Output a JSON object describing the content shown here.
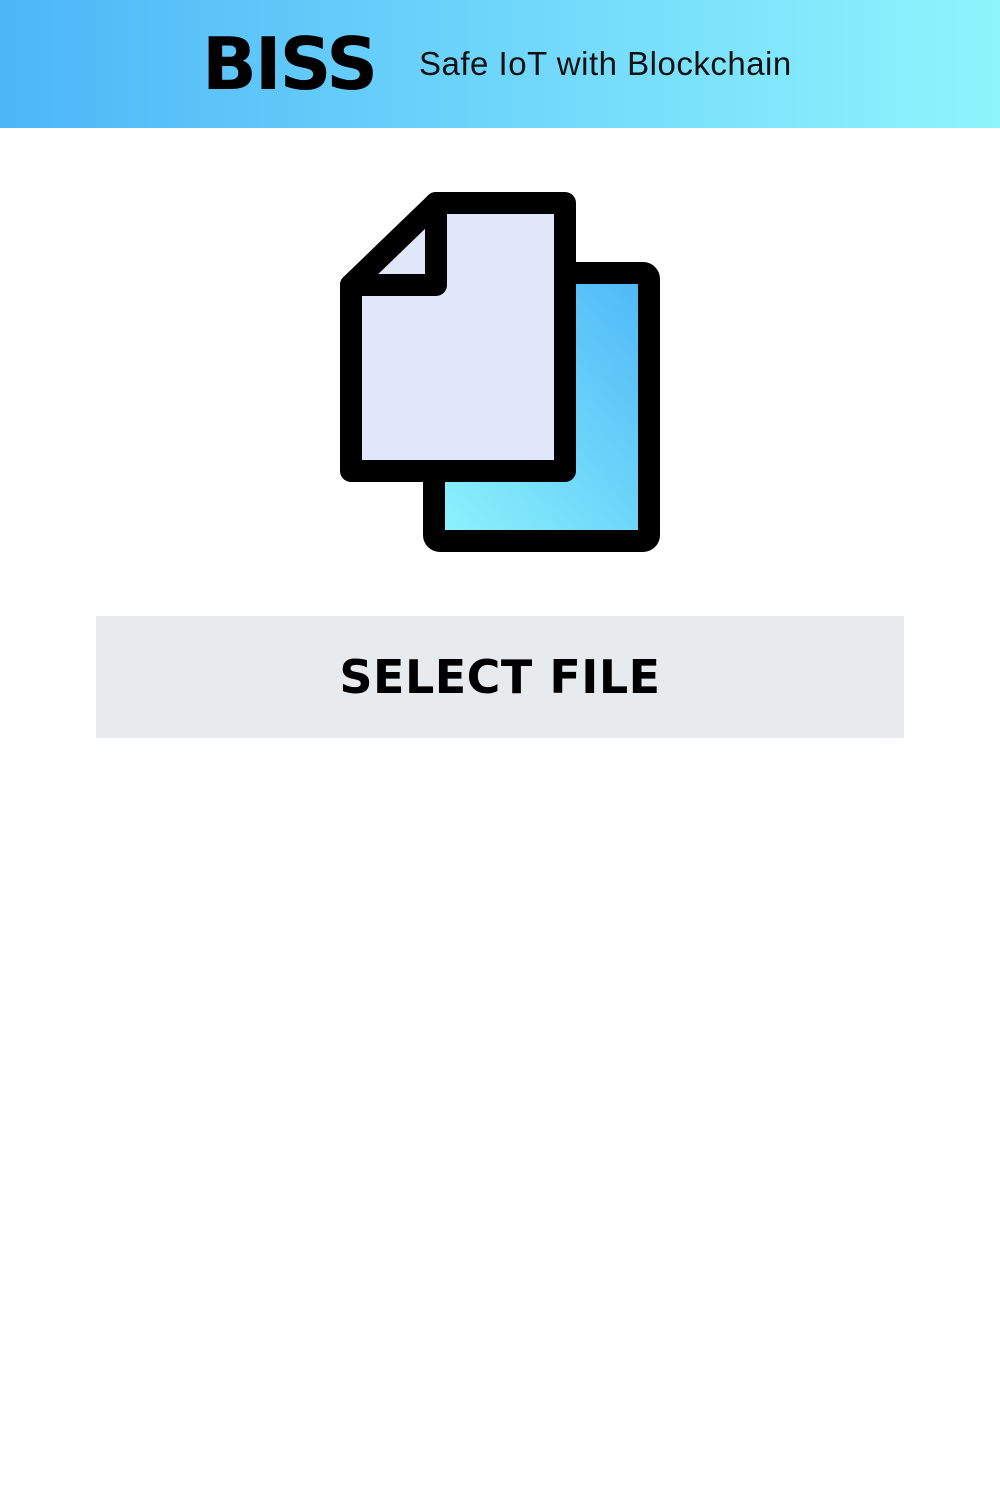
{
  "header": {
    "brand": "BISS",
    "tagline": "Safe IoT with Blockchain",
    "gradient_start": "#4db6f7",
    "gradient_end": "#8ef5fc"
  },
  "main": {
    "icon": "files-copy-icon",
    "select_button_label": "SELECT FILE",
    "button_background": "#e7ebee"
  }
}
